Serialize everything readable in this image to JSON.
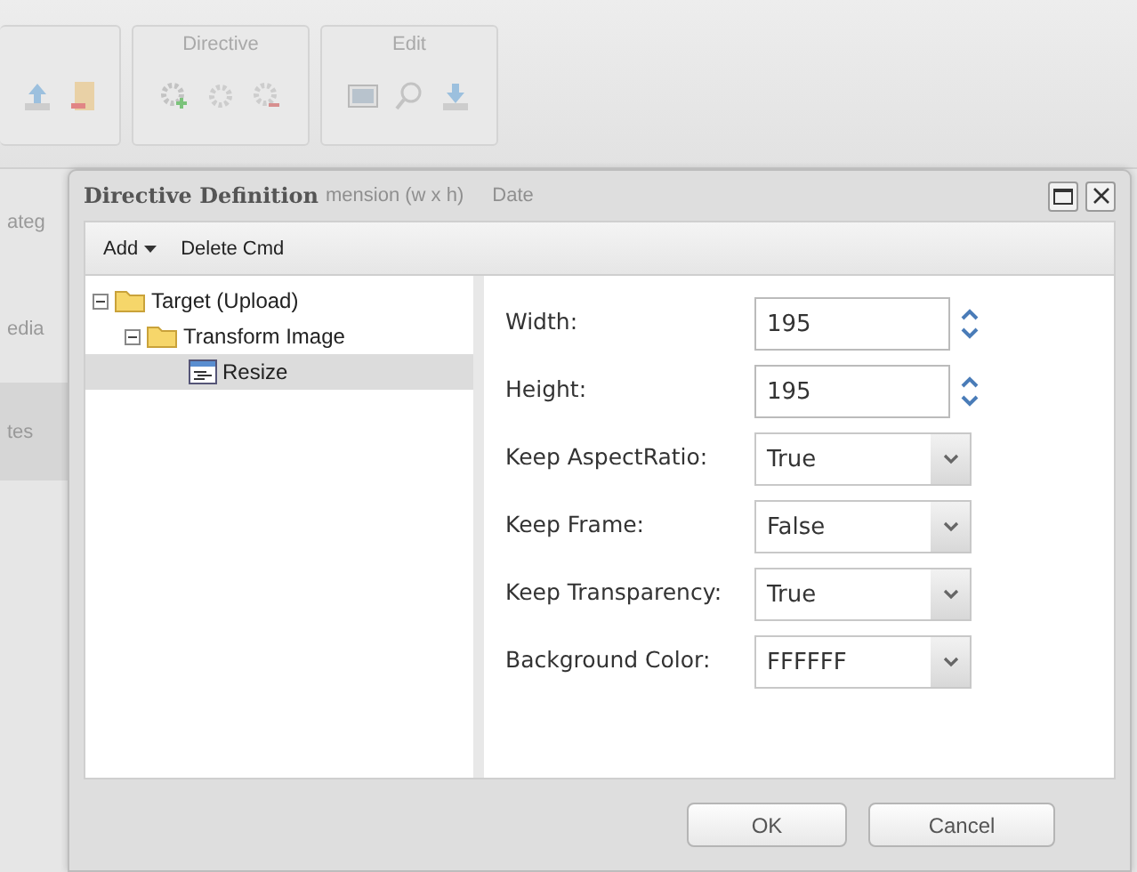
{
  "background": {
    "toolbar_groups": [
      {
        "kind": "file"
      },
      {
        "label": "Directive",
        "kind": "directive"
      },
      {
        "label": "Edit",
        "kind": "edit"
      }
    ],
    "column_headers": [
      "mension (w x h)",
      "Date"
    ],
    "side_labels": [
      "ateg",
      "edia",
      "tes"
    ]
  },
  "dialog": {
    "title": "Directive Definition",
    "toolbar": [
      {
        "label": "Add",
        "kind": "menu"
      },
      {
        "label": "Delete Cmd",
        "kind": "button"
      }
    ],
    "tree": [
      {
        "label": "Target (Upload)",
        "kind": "folder",
        "expanded": true,
        "selected": false,
        "children": [
          {
            "label": "Transform Image",
            "kind": "folder",
            "expanded": true,
            "selected": false,
            "children": [
              {
                "label": "Resize",
                "kind": "command",
                "selected": true
              }
            ]
          }
        ]
      }
    ],
    "fields": [
      {
        "label": "Width:",
        "value": "195",
        "kind": "spinner"
      },
      {
        "label": "Height:",
        "value": "195",
        "kind": "spinner"
      },
      {
        "label": "Keep AspectRatio:",
        "value": "True",
        "kind": "select"
      },
      {
        "label": "Keep Frame:",
        "value": "False",
        "kind": "select"
      },
      {
        "label": "Keep Transparency:",
        "value": "True",
        "kind": "select"
      },
      {
        "label": "Background Color:",
        "value": "FFFFFF",
        "kind": "select"
      }
    ],
    "buttons": [
      "OK",
      "Cancel"
    ]
  }
}
